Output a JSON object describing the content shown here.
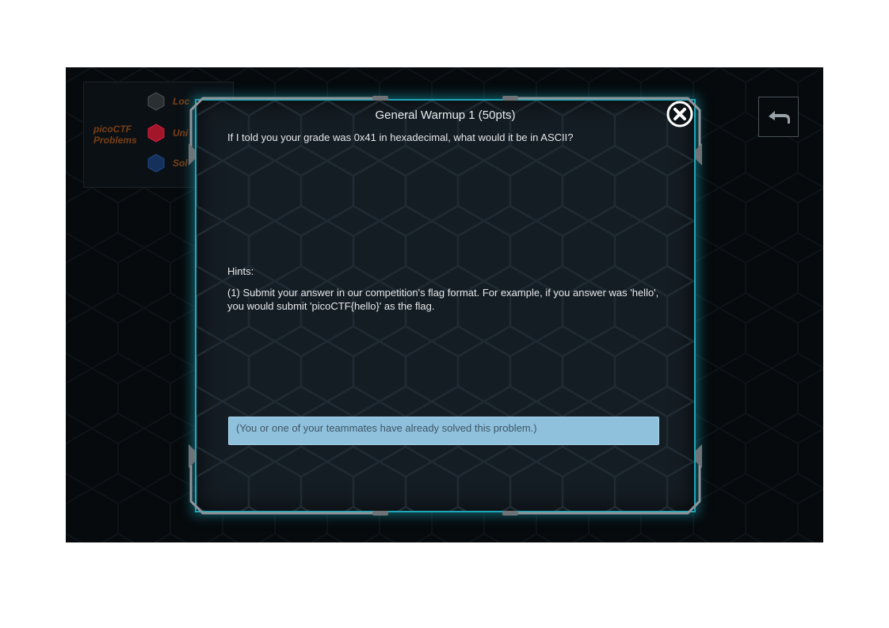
{
  "legend": {
    "title": "picoCTF Problems",
    "items": [
      {
        "label": "Loc",
        "icon": "locked-hex-icon",
        "color": "#3a3f42"
      },
      {
        "label": "Uni",
        "icon": "unsolved-hex-icon",
        "color": "#b0172a"
      },
      {
        "label": "Sol",
        "icon": "solved-hex-icon",
        "color": "#1c3a66"
      }
    ]
  },
  "back_button": {
    "icon": "back-arrow-icon"
  },
  "modal": {
    "title": "General Warmup 1 (50pts)",
    "question": "If I told you your grade was 0x41 in hexadecimal, what would it be in ASCII?",
    "hints_label": "Hints:",
    "hint_1": "(1) Submit your answer in our competition's flag format. For example, if you answer was 'hello', you would submit 'picoCTF{hello}' as the flag.",
    "solved_message": "(You or one of your teammates have already solved this problem.)",
    "close_icon": "close-icon",
    "accent_color": "#1ea7b9"
  }
}
